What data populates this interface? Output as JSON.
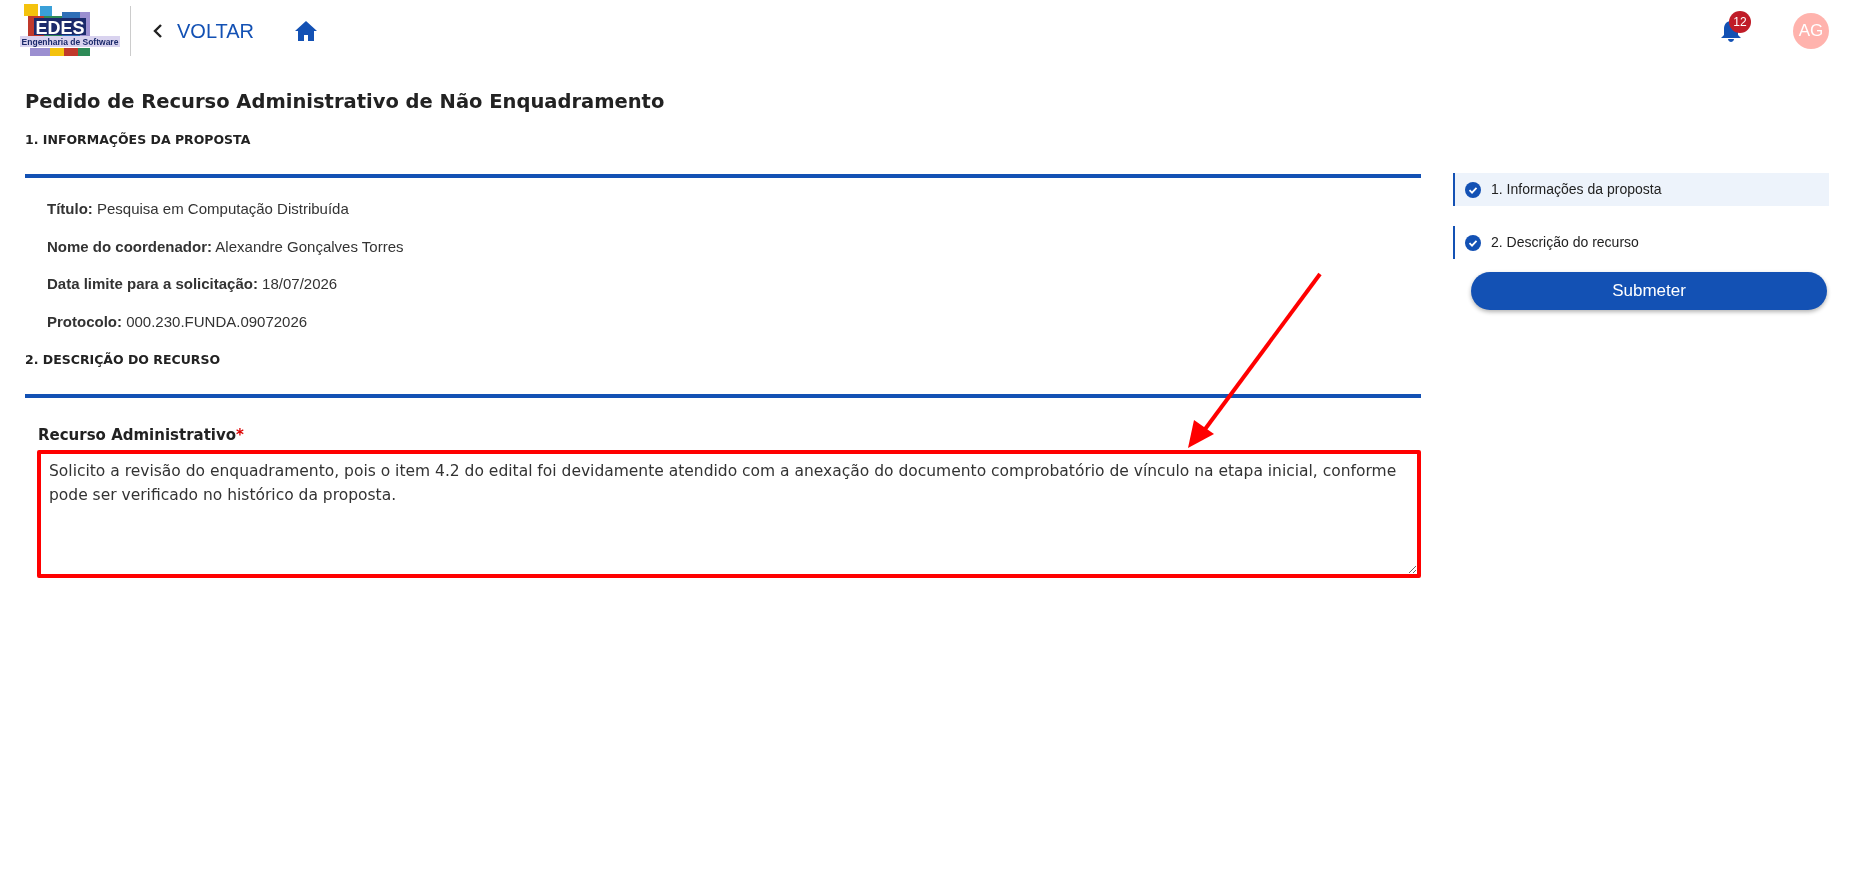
{
  "header": {
    "logo": {
      "title": "EDES",
      "subtitle": "Engenharia de Software"
    },
    "back_link": "VOLTAR",
    "notifications": {
      "count": "12"
    },
    "avatar": "AG"
  },
  "page_title": "Pedido de Recurso Administrativo de Não Enquadramento",
  "sections": [
    {
      "heading": "1. INFORMAÇÕES DA PROPOSTA",
      "fields": [
        {
          "text": "**Título:** Pesquisa em Computação Distribuída"
        },
        {
          "text": "**Nome do coordenador:** Alexandre Gonçalves Torres"
        },
        {
          "text": "**Data limite para a solicitação:** 18/07/2026"
        },
        {
          "text": "**Protocolo:** 000.230.FUNDA.09072026"
        }
      ]
    },
    {
      "heading": "2. DESCRIÇÃO DO RECURSO",
      "textarea": {
        "label": "Recurso Administrativo",
        "required": true,
        "required_mark": "*",
        "highlighted": true,
        "value": "Solicito a revisão do enquadramento, pois o item 4.2 do edital foi devidamente atendido com a anexação do documento comprobatório de vínculo na etapa inicial, conforme pode ser verificado no histórico da proposta."
      }
    }
  ],
  "steps": [
    {
      "label": "1. Informações da proposta",
      "selected": true,
      "completed": true
    },
    {
      "label": "2. Descrição do recurso",
      "selected": false,
      "completed": true
    }
  ],
  "submit_button": "Submeter"
}
